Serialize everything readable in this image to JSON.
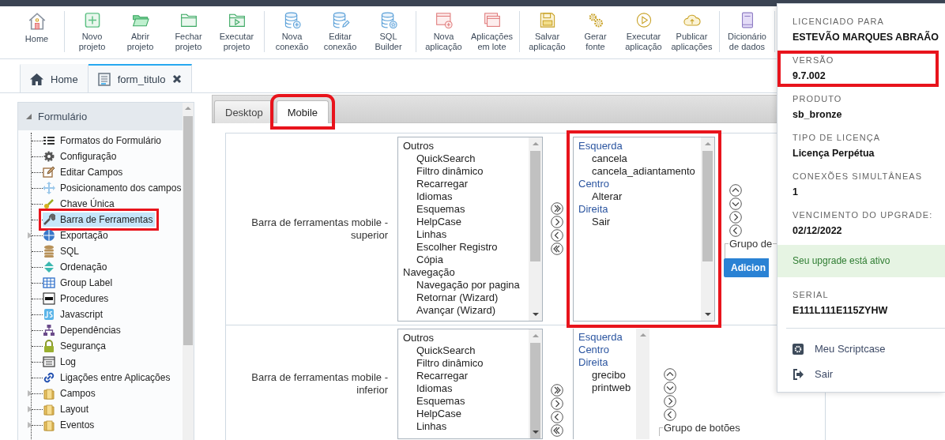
{
  "toolbar": {
    "groups": [
      {
        "items": [
          {
            "label": "Home"
          }
        ]
      },
      {
        "items": [
          {
            "label": "Novo\nprojeto"
          },
          {
            "label": "Abrir\nprojeto"
          },
          {
            "label": "Fechar\nprojeto"
          },
          {
            "label": "Executar\nprojeto"
          }
        ]
      },
      {
        "items": [
          {
            "label": "Nova\nconexão"
          },
          {
            "label": "Editar\nconexão"
          },
          {
            "label": "SQL\nBuilder"
          }
        ]
      },
      {
        "items": [
          {
            "label": "Nova\naplicação"
          },
          {
            "label": "Aplicações\nem lote"
          }
        ]
      },
      {
        "items": [
          {
            "label": "Salvar\naplicação"
          },
          {
            "label": "Gerar\nfonte"
          },
          {
            "label": "Executar\naplicação"
          },
          {
            "label": "Publicar\naplicações"
          }
        ]
      },
      {
        "items": [
          {
            "label": "Dicionário\nde dados"
          }
        ]
      }
    ]
  },
  "doc_tabs": [
    {
      "label": "Home",
      "selected": false,
      "closable": false
    },
    {
      "label": "form_titulo",
      "selected": true,
      "closable": true
    }
  ],
  "sidebar": {
    "title": "Formulário",
    "expanded": true,
    "items": [
      {
        "label": "Formatos do Formulário",
        "selected": false,
        "highlighted": false
      },
      {
        "label": "Configuração",
        "selected": false,
        "highlighted": false
      },
      {
        "label": "Editar Campos",
        "selected": false,
        "highlighted": false
      },
      {
        "label": "Posicionamento dos campos",
        "selected": false,
        "highlighted": false
      },
      {
        "label": "Chave Única",
        "selected": false,
        "highlighted": false
      },
      {
        "label": "Barra de Ferramentas",
        "selected": true,
        "highlighted": true
      },
      {
        "label": "Exportação",
        "selected": false,
        "highlighted": false,
        "expanded": false
      },
      {
        "label": "SQL",
        "selected": false,
        "highlighted": false
      },
      {
        "label": "Ordenação",
        "selected": false,
        "highlighted": false
      },
      {
        "label": "Group Label",
        "selected": false,
        "highlighted": false
      },
      {
        "label": "Procedures",
        "selected": false,
        "highlighted": false
      },
      {
        "label": "Javascript",
        "selected": false,
        "highlighted": false
      },
      {
        "label": "Dependências",
        "selected": false,
        "highlighted": false
      },
      {
        "label": "Segurança",
        "selected": false,
        "highlighted": false
      },
      {
        "label": "Log",
        "selected": false,
        "highlighted": false
      },
      {
        "label": "Ligações entre Aplicações",
        "selected": false,
        "highlighted": false
      },
      {
        "label": "Campos",
        "selected": false,
        "highlighted": false,
        "expanded": false
      },
      {
        "label": "Layout",
        "selected": false,
        "highlighted": false,
        "expanded": false
      },
      {
        "label": "Eventos",
        "selected": false,
        "highlighted": false,
        "expanded": false
      }
    ]
  },
  "editor": {
    "tabs": [
      {
        "label": "Desktop",
        "selected": false,
        "highlighted": false
      },
      {
        "label": "Mobile",
        "selected": true,
        "highlighted": true
      }
    ],
    "rows": [
      {
        "label": "Barra de ferramentas mobile - superior",
        "available": [
          {
            "kind": "category",
            "text": "Outros"
          },
          {
            "kind": "option",
            "text": "QuickSearch"
          },
          {
            "kind": "option",
            "text": "Filtro dinâmico"
          },
          {
            "kind": "option",
            "text": "Recarregar"
          },
          {
            "kind": "option",
            "text": "Idiomas"
          },
          {
            "kind": "option",
            "text": "Esquemas"
          },
          {
            "kind": "option",
            "text": "HelpCase"
          },
          {
            "kind": "option",
            "text": "Linhas"
          },
          {
            "kind": "option",
            "text": "Escolher Registro"
          },
          {
            "kind": "option",
            "text": "Cópia"
          },
          {
            "kind": "category",
            "text": "Navegação"
          },
          {
            "kind": "option",
            "text": "Navegação por pagina"
          },
          {
            "kind": "option",
            "text": "Retornar (Wizard)"
          },
          {
            "kind": "option",
            "text": "Avançar (Wizard)"
          }
        ],
        "chosen": {
          "highlighted": true,
          "items": [
            {
              "kind": "section",
              "text": "Esquerda"
            },
            {
              "kind": "option",
              "text": "cancela"
            },
            {
              "kind": "option",
              "text": "cancela_adiantamento"
            },
            {
              "kind": "section",
              "text": "Centro"
            },
            {
              "kind": "option",
              "text": "Alterar"
            },
            {
              "kind": "section",
              "text": "Direita"
            },
            {
              "kind": "option",
              "text": "Sair"
            }
          ]
        },
        "group_legend": "Grupo de",
        "add_button": "Adicion"
      },
      {
        "label": "Barra de ferramentas mobile - inferior",
        "available": [
          {
            "kind": "category",
            "text": "Outros"
          },
          {
            "kind": "option",
            "text": "QuickSearch"
          },
          {
            "kind": "option",
            "text": "Filtro dinâmico"
          },
          {
            "kind": "option",
            "text": "Recarregar"
          },
          {
            "kind": "option",
            "text": "Idiomas"
          },
          {
            "kind": "option",
            "text": "Esquemas"
          },
          {
            "kind": "option",
            "text": "HelpCase"
          },
          {
            "kind": "option",
            "text": "Linhas"
          }
        ],
        "chosen": {
          "highlighted": false,
          "items": [
            {
              "kind": "section",
              "text": "Esquerda"
            },
            {
              "kind": "section",
              "text": "Centro"
            },
            {
              "kind": "section",
              "text": "Direita"
            },
            {
              "kind": "option",
              "text": "grecibo"
            },
            {
              "kind": "option",
              "text": "printweb"
            }
          ]
        },
        "group_legend": "Grupo de botões"
      }
    ]
  },
  "license_panel": {
    "entries": [
      {
        "kind": "field",
        "label": "LICENCIADO PARA",
        "value": "ESTEVÃO MARQUES ABRAÃO",
        "highlighted": false
      },
      {
        "kind": "field",
        "label": "VERSÃO",
        "value": "9.7.002",
        "highlighted": true
      },
      {
        "kind": "field",
        "label": "PRODUTO",
        "value": "sb_bronze",
        "highlighted": false
      },
      {
        "kind": "field",
        "label": "TIPO DE LICENÇA",
        "value": "Licença Perpétua",
        "highlighted": false
      },
      {
        "kind": "field",
        "label": "CONEXÕES SIMULTÂNEAS",
        "value": "1",
        "highlighted": false
      },
      {
        "kind": "field",
        "label": "VENCIMENTO DO UPGRADE:",
        "value": "02/12/2022",
        "highlighted": false
      },
      {
        "kind": "status",
        "text": "Seu upgrade está ativo"
      },
      {
        "kind": "field",
        "label": "SERIAL",
        "value": "E111L111E115ZYHW",
        "highlighted": false
      }
    ],
    "menu": [
      {
        "label": "Meu Scriptcase"
      },
      {
        "label": "Sair"
      }
    ]
  }
}
